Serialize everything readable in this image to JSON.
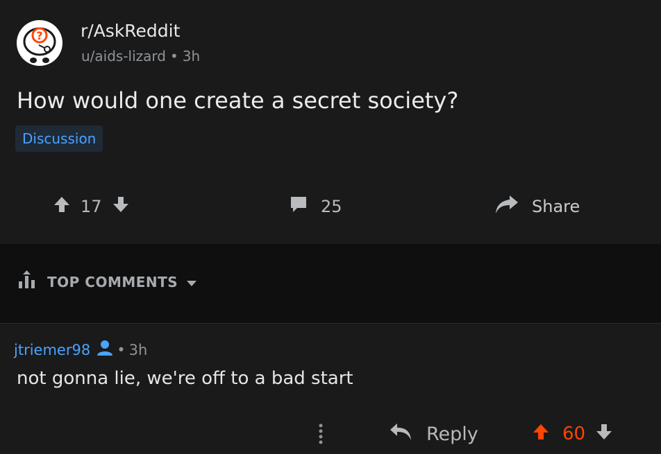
{
  "post": {
    "subreddit": "r/AskReddit",
    "author": "u/aids-lizard",
    "separator": "•",
    "age": "3h",
    "title": "How would one create a secret society?",
    "flair": "Discussion",
    "score": "17",
    "comments": "25",
    "share_label": "Share"
  },
  "sort": {
    "label": "TOP COMMENTS"
  },
  "comment": {
    "username": "jtriemer98",
    "separator": "•",
    "age": "3h",
    "body": "not gonna lie, we're off to a bad start",
    "reply_label": "Reply",
    "score": "60"
  },
  "colors": {
    "background": "#1a1a1b",
    "band": "#0f0f10",
    "link_blue": "#4aa3ff",
    "upvote_orange": "#ff4500",
    "muted_text": "#8f9498"
  },
  "icons": [
    "subreddit-avatar-icon",
    "upvote-icon",
    "downvote-icon",
    "comment-icon",
    "share-icon",
    "sort-icon",
    "caret-down-icon",
    "user-icon",
    "more-icon",
    "reply-icon"
  ]
}
